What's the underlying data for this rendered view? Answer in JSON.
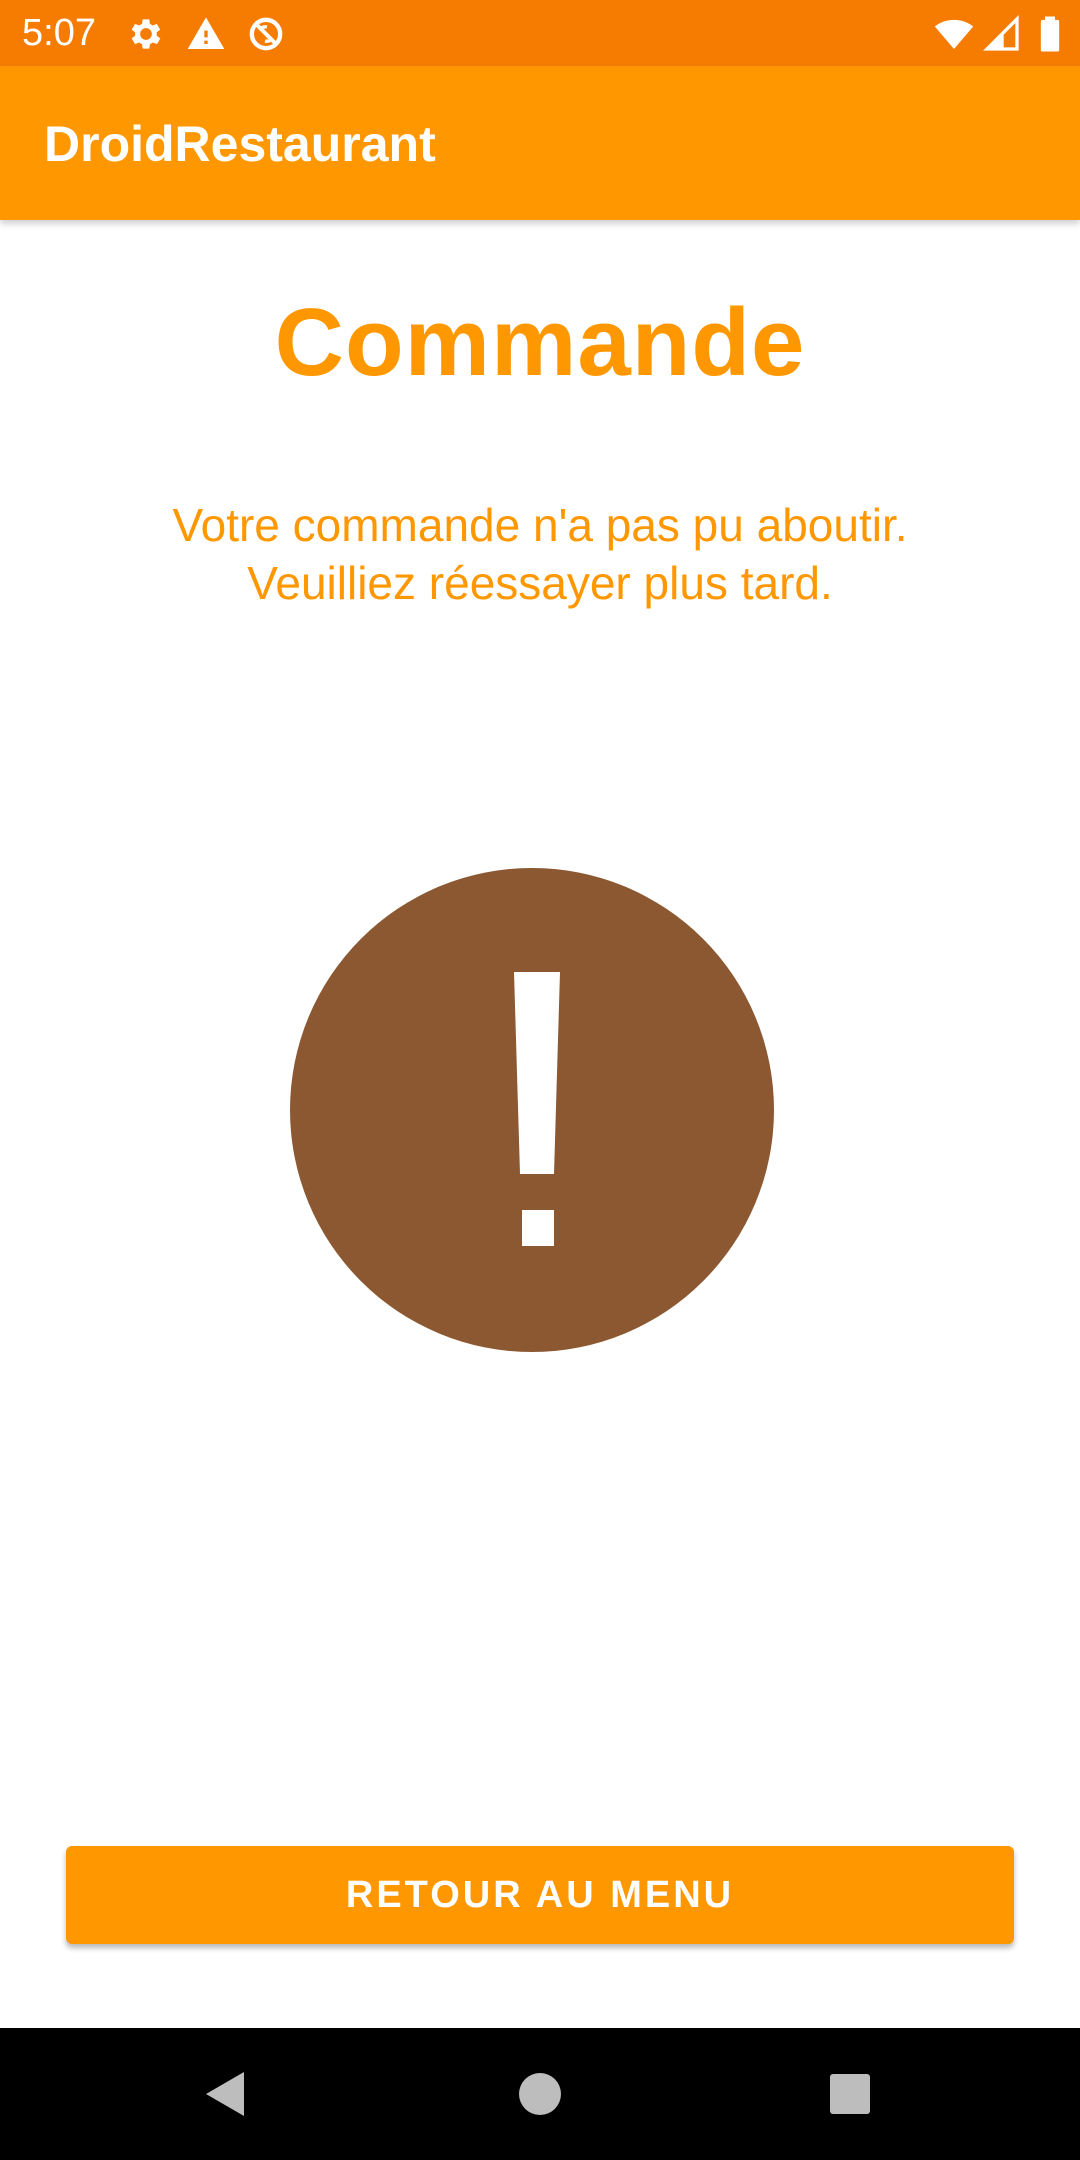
{
  "status_bar": {
    "time": "5:07",
    "left_icons": [
      "settings-gear-icon",
      "warning-icon",
      "sync-disabled-icon"
    ],
    "right_icons": [
      "wifi-icon",
      "cellular-signal-icon",
      "battery-icon"
    ]
  },
  "app_bar": {
    "title": "DroidRestaurant"
  },
  "main": {
    "title": "Commande",
    "message_line1": "Votre commande n'a pas pu aboutir.",
    "message_line2": "Veuilliez réessayer plus tard.",
    "illustration_icon": "exclamation-circle-icon"
  },
  "actions": {
    "return_label": "RETOUR AU MENU"
  },
  "nav_bar": {
    "icons": [
      "back-icon",
      "home-icon",
      "recents-icon"
    ]
  },
  "colors": {
    "status_bar": "#f57c00",
    "primary": "#ff9800",
    "alert_circle": "#8b5831",
    "nav_bar": "#000000",
    "background": "#ffffff"
  }
}
